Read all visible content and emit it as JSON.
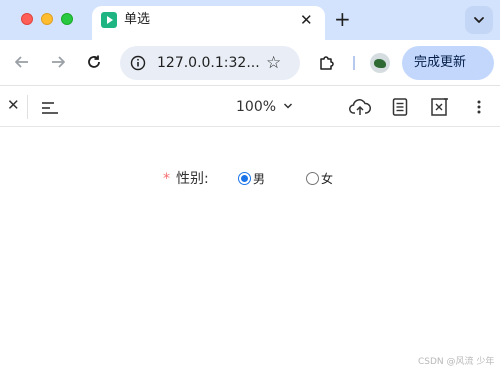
{
  "browser": {
    "tab": {
      "title": "单选",
      "close": "✕"
    },
    "new_tab": "+",
    "address": {
      "url": "127.0.0.1:32...",
      "star": "☆"
    },
    "update_button": "完成更新"
  },
  "pdf_toolbar": {
    "close": "✕",
    "zoom": "100%"
  },
  "form": {
    "required_mark": "*",
    "label": "性别:",
    "options": [
      {
        "label": "男",
        "checked": true
      },
      {
        "label": "女",
        "checked": false
      }
    ]
  },
  "watermark": "CSDN @风流 少年",
  "colors": {
    "tab_strip": "#d3e3fd",
    "accent": "#1a73e8",
    "required": "#f56c6c"
  }
}
